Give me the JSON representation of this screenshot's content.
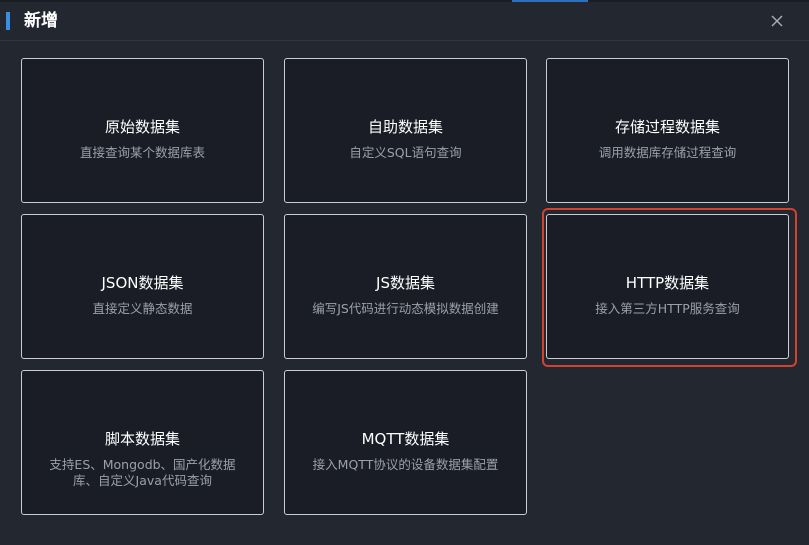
{
  "dialog": {
    "title": "新增",
    "close_icon": "close-icon"
  },
  "cards": [
    {
      "title": "原始数据集",
      "desc": "直接查询某个数据库表"
    },
    {
      "title": "自助数据集",
      "desc": "自定义SQL语句查询"
    },
    {
      "title": "存储过程数据集",
      "desc": "调用数据库存储过程查询"
    },
    {
      "title": "JSON数据集",
      "desc": "直接定义静态数据"
    },
    {
      "title": "JS数据集",
      "desc": "编写JS代码进行动态模拟数据创建"
    },
    {
      "title": "HTTP数据集",
      "desc": "接入第三方HTTP服务查询",
      "selected": true
    },
    {
      "title": "脚本数据集",
      "desc": "支持ES、Mongodb、国产化数据库、自定义Java代码查询"
    },
    {
      "title": "MQTT数据集",
      "desc": "接入MQTT协议的设备数据集配置"
    }
  ],
  "colors": {
    "accent_bar": "#3a8ee6",
    "selection_highlight": "#d2432f"
  }
}
